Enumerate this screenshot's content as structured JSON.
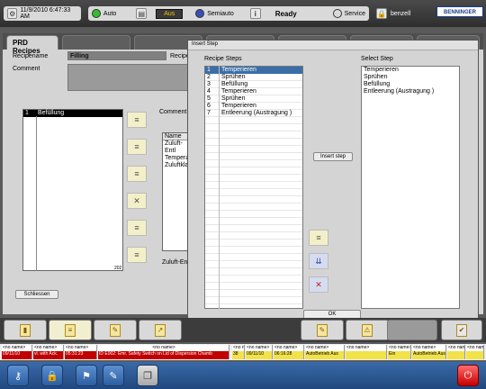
{
  "topbar": {
    "datetime": "11/9/2010 6:47:33 AM",
    "mode_auto": "Auto",
    "mode_off": "Aus",
    "mode_semiauto": "Semiauto",
    "status": "Ready",
    "mode_service": "Service",
    "user": "benzell",
    "brand": "BENNINGER",
    "colors": {
      "auto": "#2ec02e",
      "semiauto": "#3a4fb8",
      "service": "#d9d9d9",
      "off_text": "#f0c000"
    }
  },
  "main": {
    "tab_title": "PRD Recipes",
    "recipename_label": "Recipename",
    "recipename_value": "Filling",
    "recipe_label_2": "Recipe",
    "comment_label": "Comment",
    "steps": [
      {
        "num": "1",
        "name": "Befüllung"
      }
    ],
    "count": "202",
    "comment2_label": "Comment",
    "table_header": "Name",
    "table_rows": [
      "Zuluft-Entl",
      "Temperatu",
      "Zuluftklapp"
    ],
    "bottom_field_label": "Zuluft-Entl",
    "close_button": "Schliessen"
  },
  "dialog": {
    "title": "Insert Step",
    "recipe_steps_label": "Recipe Steps",
    "select_step_label": "Select Step",
    "recipe_steps": [
      {
        "num": "1",
        "name": "Temperieren",
        "selected": true
      },
      {
        "num": "2",
        "name": "Sprühen"
      },
      {
        "num": "3",
        "name": "Befüllung"
      },
      {
        "num": "4",
        "name": "Temperieren"
      },
      {
        "num": "5",
        "name": "Sprühen"
      },
      {
        "num": "6",
        "name": "Temperieren"
      },
      {
        "num": "7",
        "name": "Entleerung (Austragung )"
      }
    ],
    "select_steps": [
      "Temperieren",
      "Sprühen",
      "Befüllung",
      "Entleerung (Austragung )"
    ],
    "insert_button": "Insert step",
    "ok_button": "OK"
  },
  "alarms": {
    "left": [
      {
        "hdr": "<no name>",
        "val": "09/11/10"
      },
      {
        "hdr": "<no name>",
        "val": "vl. with Ack."
      },
      {
        "hdr": "<no name>",
        "val": "05:31:23"
      },
      {
        "hdr": "<no name>",
        "val": "ID E002: Emr. Safety Switch on Lid of Dispersion Chamb"
      }
    ],
    "right": [
      {
        "hdr": "<no name>",
        "val": "38"
      },
      {
        "hdr": "<no name>",
        "val": "09/11/10"
      },
      {
        "hdr": "<no name>",
        "val": "06:16:28"
      },
      {
        "hdr": "<no name>",
        "val": "AutoBetrieb Aus"
      },
      {
        "hdr": "<no name>",
        "val": ""
      },
      {
        "hdr": "<no name>",
        "val": "Ein"
      },
      {
        "hdr": "<no name>",
        "val": "AutoBetrieb Aus"
      },
      {
        "hdr": "<no name>",
        "val": ""
      },
      {
        "hdr": "<no name>",
        "val": ""
      }
    ]
  }
}
